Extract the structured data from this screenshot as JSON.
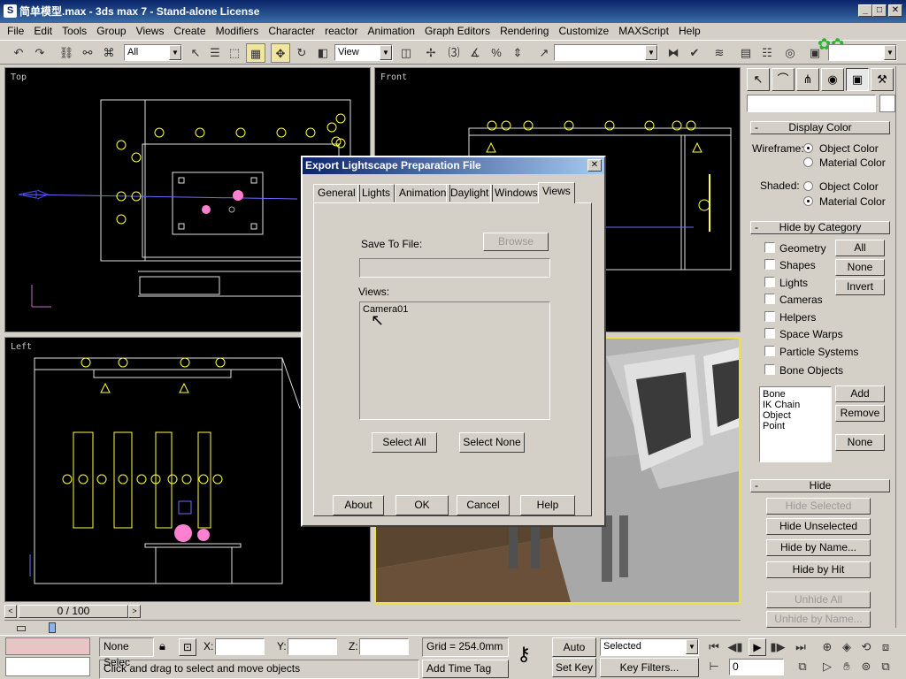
{
  "window": {
    "title": "简单模型.max - 3ds max 7 - Stand-alone License",
    "app_icon": "3ds-max-icon"
  },
  "menu": [
    "File",
    "Edit",
    "Tools",
    "Group",
    "Views",
    "Create",
    "Modifiers",
    "Character",
    "reactor",
    "Animation",
    "Graph Editors",
    "Rendering",
    "Customize",
    "MAXScript",
    "Help"
  ],
  "toolbar": {
    "selection_filter": "All",
    "ref_coord": "View",
    "named_selection": ""
  },
  "viewports": {
    "top": "Top",
    "front": "Front",
    "left": "Left"
  },
  "dialog": {
    "title": "Export Lightscape Preparation File",
    "tabs": [
      "General",
      "Lights",
      "Animation",
      "Daylight",
      "Windows",
      "Views"
    ],
    "active_tab": "Views",
    "save_to_file_label": "Save To File:",
    "browse_label": "Browse",
    "file_value": "",
    "views_label": "Views:",
    "views_items": [
      "Camera01"
    ],
    "select_all": "Select All",
    "select_none": "Select None",
    "about": "About",
    "ok": "OK",
    "cancel": "Cancel",
    "help": "Help"
  },
  "command_panel": {
    "display_color": {
      "title": "Display Color",
      "wireframe_label": "Wireframe:",
      "shaded_label": "Shaded:",
      "object_color": "Object Color",
      "material_color": "Material Color"
    },
    "hide_by_category": {
      "title": "Hide by Category",
      "categories": [
        "Geometry",
        "Shapes",
        "Lights",
        "Cameras",
        "Helpers",
        "Space Warps",
        "Particle Systems",
        "Bone Objects"
      ],
      "all": "All",
      "none": "None",
      "invert": "Invert",
      "list": [
        "Bone",
        "IK Chain Object",
        "Point"
      ],
      "add": "Add",
      "remove": "Remove",
      "none2": "None"
    },
    "hide": {
      "title": "Hide",
      "hide_selected": "Hide Selected",
      "hide_unselected": "Hide Unselected",
      "hide_by_name": "Hide by Name...",
      "hide_by_hit": "Hide by Hit",
      "unhide_all": "Unhide All",
      "unhide_by_name": "Unhide by Name..."
    }
  },
  "timeline": {
    "frame": "0 / 100"
  },
  "statusbar": {
    "selection": "None Selec",
    "x_label": "X:",
    "y_label": "Y:",
    "z_label": "Z:",
    "grid": "Grid = 254.0mm",
    "prompt": "Click and drag to select and move objects",
    "add_time_tag": "Add Time Tag",
    "auto_key": "Auto Key",
    "set_key": "Set Key",
    "selected": "Selected",
    "key_filters": "Key Filters...",
    "frame_value": "0"
  }
}
